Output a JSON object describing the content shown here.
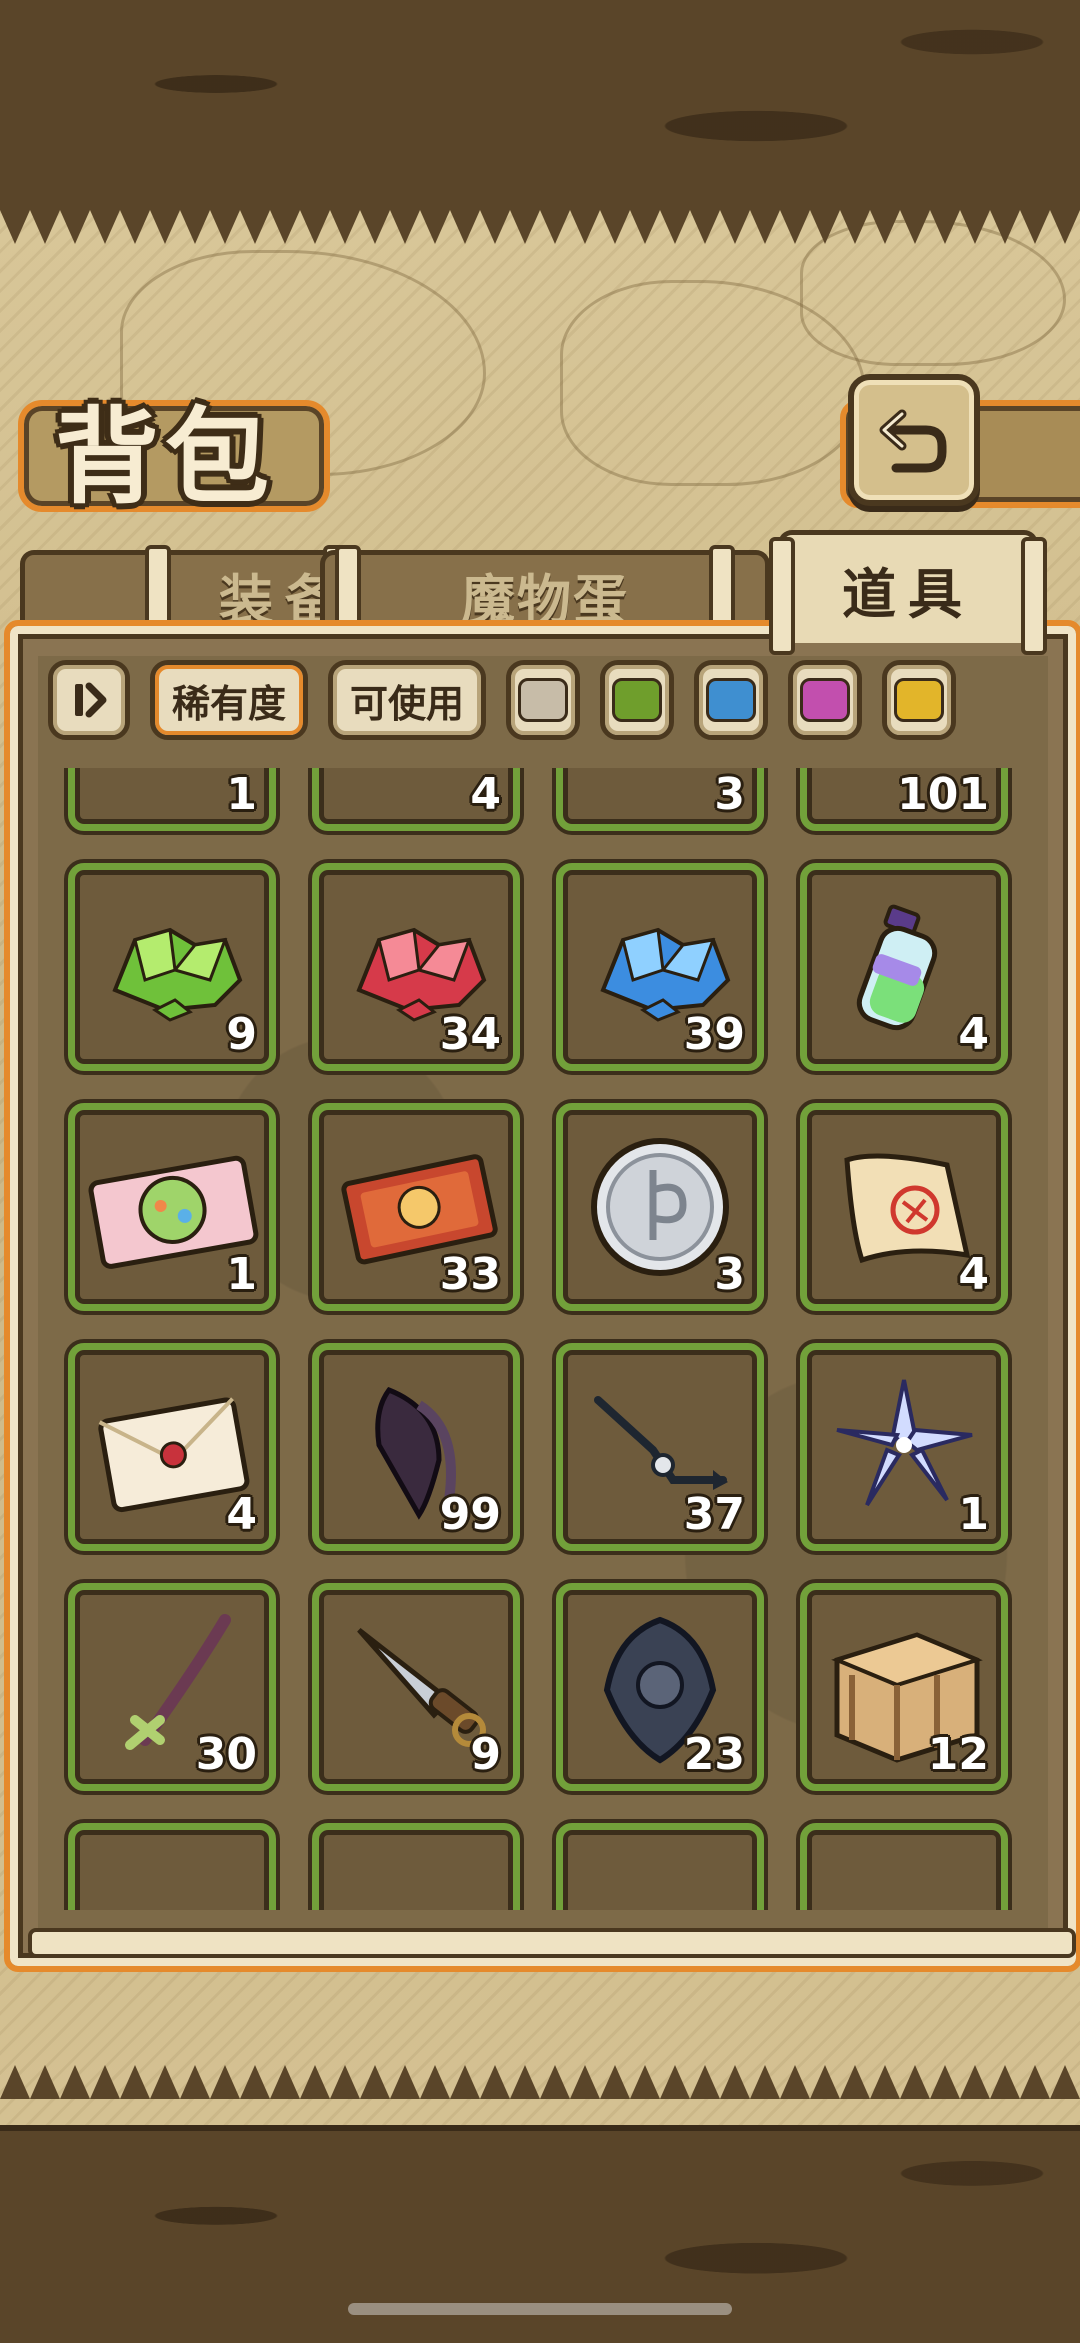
{
  "header": {
    "title": "背包"
  },
  "tabs": [
    {
      "label": "装备",
      "active": false
    },
    {
      "label": "魔物蛋",
      "active": false
    },
    {
      "label": "道具",
      "active": true
    }
  ],
  "filters": {
    "rarity_label": "稀有度",
    "usable_label": "可使用",
    "rarity_colors": [
      "#c7bca8",
      "#6f9e2c",
      "#3f8fd0",
      "#c24fae",
      "#e2b52a"
    ]
  },
  "items_partial_top": [
    {
      "qty": "1",
      "icon": "partial-item-icon"
    },
    {
      "qty": "4",
      "icon": "partial-item-icon"
    },
    {
      "qty": "3",
      "icon": "partial-item-icon"
    },
    {
      "qty": "101",
      "icon": "partial-item-icon"
    }
  ],
  "items": [
    {
      "qty": "9",
      "icon": "green-crystal-icon"
    },
    {
      "qty": "34",
      "icon": "red-crystal-icon"
    },
    {
      "qty": "39",
      "icon": "blue-crystal-icon"
    },
    {
      "qty": "4",
      "icon": "potion-bottle-icon"
    },
    {
      "qty": "1",
      "icon": "pink-ticket-icon"
    },
    {
      "qty": "33",
      "icon": "red-ticket-icon"
    },
    {
      "qty": "3",
      "icon": "silver-coin-icon"
    },
    {
      "qty": "4",
      "icon": "scroll-map-icon"
    },
    {
      "qty": "4",
      "icon": "sealed-letter-icon"
    },
    {
      "qty": "99",
      "icon": "dark-feather-icon"
    },
    {
      "qty": "37",
      "icon": "clock-hand-icon"
    },
    {
      "qty": "1",
      "icon": "blue-flower-icon"
    },
    {
      "qty": "30",
      "icon": "wand-branch-icon"
    },
    {
      "qty": "9",
      "icon": "dagger-icon"
    },
    {
      "qty": "23",
      "icon": "dark-emblem-icon"
    },
    {
      "qty": "12",
      "icon": "wooden-crate-icon"
    }
  ]
}
